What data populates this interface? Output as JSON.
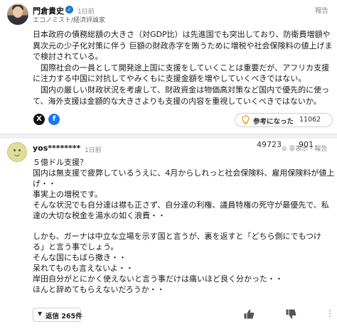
{
  "expert": {
    "name": "門倉貴史",
    "time": "1日前",
    "title": "エコノミスト/経済評論家",
    "report": "報告",
    "paragraphs": [
      "日本政府の債務総額の大きさ（対GDP比）は先進国でも突出しており、防衛費増額や",
      "異次元の少子化対策に伴う 巨額の財政赤字を賄うために増税や社会保険料の値上げま",
      "で検討されている。",
      "　国際社会の一員として開発途上国に支援をしていくことは重要だが、アフリカ支援",
      "に注力する中国に対抗してやみくもに支援金額を増やしていくべきではない。",
      "　国内の厳しい財政状況を考慮して、財政資金は物価高対策など国内で優先的に使っ",
      "て、海外支援は金額的な大きさよりも支援の内容を重視していくべきではないか。"
    ],
    "helpful_label": "参考になった",
    "helpful_count": "11062",
    "share_x": "X",
    "share_fb": "f"
  },
  "comment": {
    "user": "yos********",
    "time": "1日前",
    "hide_label": "非表示・報告",
    "lines": [
      "５億ドル支援？",
      "国内は無支援で疲弊しているうえに、4月からしれっと社会保険料、雇用保険料が値上",
      "げ・・",
      "事実上の増税です。",
      "そんな状況でも自分達は襟も正さず、自分達の利権、議員特権の死守が最優先で、私",
      "達の大切な税金を湯水の如く浪費・・",
      "",
      "しかも、ガーナは中立な立場を示す国と言うが、裏を返すと「どちら側にでもつけ",
      "る」と言う事でしょう。",
      "そんな国にもばら撒き・・",
      "呆れてものも言えないよ・・",
      "岸田自分がとにかく使えないと言う事だけは痛いほど良く分かった・・",
      "ほんと辞めてもらえないだろうか・・"
    ],
    "replies_label": "返信 265件",
    "likes": "49723",
    "dislikes": "901"
  },
  "colors": {
    "verified": "#1d76d6",
    "facebook": "#1877f2",
    "muted_text": "#8a8a8a"
  },
  "icons": [
    "verified-badge-icon",
    "x-share-icon",
    "facebook-share-icon",
    "lightbulb-icon",
    "chevron-down-icon",
    "thumbs-up-icon",
    "thumbs-down-icon",
    "more-options-icon"
  ]
}
